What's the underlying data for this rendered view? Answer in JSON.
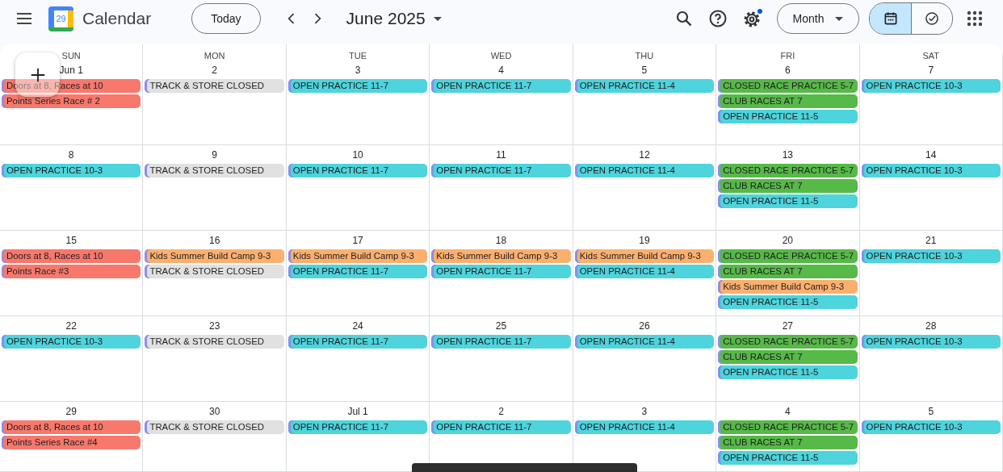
{
  "app": {
    "logo_day": "29",
    "title": "Calendar"
  },
  "toolbar": {
    "today": "Today",
    "period": "June 2025",
    "view": "Month",
    "view_toggle": [
      {
        "kind": "calendar",
        "selected": true
      },
      {
        "kind": "tasks",
        "selected": false
      }
    ]
  },
  "weekdays": [
    "SUN",
    "MON",
    "TUE",
    "WED",
    "THU",
    "FRI",
    "SAT"
  ],
  "weeks": [
    [
      {
        "date": "Jun 1",
        "events": [
          {
            "title": "Doors at 8, Races at 10",
            "color": "#f8786c"
          },
          {
            "title": "Points Series Race # 2",
            "color": "#f8786c"
          }
        ]
      },
      {
        "date": "2",
        "events": [
          {
            "title": "TRACK & STORE CLOSED",
            "color": "#e1e1e1"
          }
        ]
      },
      {
        "date": "3",
        "events": [
          {
            "title": "OPEN PRACTICE 11-7",
            "color": "#4dd4dd"
          }
        ]
      },
      {
        "date": "4",
        "events": [
          {
            "title": "OPEN PRACTICE 11-7",
            "color": "#4dd4dd"
          }
        ]
      },
      {
        "date": "5",
        "events": [
          {
            "title": "OPEN PRACTICE 11-4",
            "color": "#4dd4dd"
          }
        ]
      },
      {
        "date": "6",
        "events": [
          {
            "title": "CLOSED RACE PRACTICE 5-7",
            "color": "#56b948"
          },
          {
            "title": "CLUB RACES AT 7",
            "color": "#56b948"
          },
          {
            "title": "OPEN PRACTICE 11-5",
            "color": "#4dd4dd"
          }
        ]
      },
      {
        "date": "7",
        "events": [
          {
            "title": "OPEN PRACTICE 10-3",
            "color": "#4dd4dd"
          }
        ]
      }
    ],
    [
      {
        "date": "8",
        "events": [
          {
            "title": "OPEN PRACTICE 10-3",
            "color": "#4dd4dd"
          }
        ]
      },
      {
        "date": "9",
        "events": [
          {
            "title": "TRACK & STORE CLOSED",
            "color": "#e1e1e1"
          }
        ]
      },
      {
        "date": "10",
        "events": [
          {
            "title": "OPEN PRACTICE 11-7",
            "color": "#4dd4dd"
          }
        ]
      },
      {
        "date": "11",
        "events": [
          {
            "title": "OPEN PRACTICE 11-7",
            "color": "#4dd4dd"
          }
        ]
      },
      {
        "date": "12",
        "events": [
          {
            "title": "OPEN PRACTICE 11-4",
            "color": "#4dd4dd"
          }
        ]
      },
      {
        "date": "13",
        "events": [
          {
            "title": "CLOSED RACE PRACTICE 5-7",
            "color": "#56b948"
          },
          {
            "title": "CLUB RACES AT 7",
            "color": "#56b948"
          },
          {
            "title": "OPEN PRACTICE 11-5",
            "color": "#4dd4dd"
          }
        ]
      },
      {
        "date": "14",
        "events": [
          {
            "title": "OPEN PRACTICE 10-3",
            "color": "#4dd4dd"
          }
        ]
      }
    ],
    [
      {
        "date": "15",
        "events": [
          {
            "title": "Doors at 8, Races at 10",
            "color": "#f8786c"
          },
          {
            "title": "Points Race #3",
            "color": "#f8786c"
          }
        ]
      },
      {
        "date": "16",
        "events": [
          {
            "title": "Kids Summer Build Camp 9-3",
            "color": "#fbb070"
          },
          {
            "title": "TRACK & STORE CLOSED",
            "color": "#e1e1e1"
          }
        ]
      },
      {
        "date": "17",
        "events": [
          {
            "title": "Kids Summer Build Camp 9-3",
            "color": "#fbb070"
          },
          {
            "title": "OPEN PRACTICE 11-7",
            "color": "#4dd4dd"
          }
        ]
      },
      {
        "date": "18",
        "events": [
          {
            "title": "Kids Summer Build Camp 9-3",
            "color": "#fbb070"
          },
          {
            "title": "OPEN PRACTICE 11-7",
            "color": "#4dd4dd"
          }
        ]
      },
      {
        "date": "19",
        "events": [
          {
            "title": "Kids Summer Build Camp 9-3",
            "color": "#fbb070"
          },
          {
            "title": "OPEN PRACTICE 11-4",
            "color": "#4dd4dd"
          }
        ]
      },
      {
        "date": "20",
        "events": [
          {
            "title": "CLOSED RACE PRACTICE 5-7",
            "color": "#56b948"
          },
          {
            "title": "CLUB RACES AT 7",
            "color": "#56b948"
          },
          {
            "title": "Kids Summer Build Camp 9-3",
            "color": "#fbb070"
          },
          {
            "title": "OPEN PRACTICE 11-5",
            "color": "#4dd4dd"
          }
        ]
      },
      {
        "date": "21",
        "events": [
          {
            "title": "OPEN PRACTICE 10-3",
            "color": "#4dd4dd"
          }
        ]
      }
    ],
    [
      {
        "date": "22",
        "events": [
          {
            "title": "OPEN PRACTICE 10-3",
            "color": "#4dd4dd"
          }
        ]
      },
      {
        "date": "23",
        "events": [
          {
            "title": "TRACK & STORE CLOSED",
            "color": "#e1e1e1"
          }
        ]
      },
      {
        "date": "24",
        "events": [
          {
            "title": "OPEN PRACTICE 11-7",
            "color": "#4dd4dd"
          }
        ]
      },
      {
        "date": "25",
        "events": [
          {
            "title": "OPEN PRACTICE 11-7",
            "color": "#4dd4dd"
          }
        ]
      },
      {
        "date": "26",
        "events": [
          {
            "title": "OPEN PRACTICE 11-4",
            "color": "#4dd4dd"
          }
        ]
      },
      {
        "date": "27",
        "events": [
          {
            "title": "CLOSED RACE PRACTICE 5-7",
            "color": "#56b948"
          },
          {
            "title": "CLUB RACES AT 7",
            "color": "#56b948"
          },
          {
            "title": "OPEN PRACTICE 11-5",
            "color": "#4dd4dd"
          }
        ]
      },
      {
        "date": "28",
        "events": [
          {
            "title": "OPEN PRACTICE 10-3",
            "color": "#4dd4dd"
          }
        ]
      }
    ],
    [
      {
        "date": "29",
        "events": [
          {
            "title": "Doors at 8, Races at 10",
            "color": "#f8786c"
          },
          {
            "title": "Points Series Race #4",
            "color": "#f8786c"
          }
        ]
      },
      {
        "date": "30",
        "events": [
          {
            "title": "TRACK & STORE CLOSED",
            "color": "#e1e1e1"
          }
        ]
      },
      {
        "date": "Jul 1",
        "events": [
          {
            "title": "OPEN PRACTICE 11-7",
            "color": "#4dd4dd"
          }
        ]
      },
      {
        "date": "2",
        "events": [
          {
            "title": "OPEN PRACTICE 11-7",
            "color": "#4dd4dd"
          }
        ]
      },
      {
        "date": "3",
        "events": [
          {
            "title": "OPEN PRACTICE 11-4",
            "color": "#4dd4dd"
          }
        ]
      },
      {
        "date": "4",
        "events": [
          {
            "title": "CLOSED RACE PRACTICE 5-7",
            "color": "#56b948"
          },
          {
            "title": "CLUB RACES AT 7",
            "color": "#56b948"
          },
          {
            "title": "OPEN PRACTICE 11-5",
            "color": "#4dd4dd"
          }
        ]
      },
      {
        "date": "5",
        "events": [
          {
            "title": "OPEN PRACTICE 10-3",
            "color": "#4dd4dd"
          }
        ]
      }
    ]
  ]
}
